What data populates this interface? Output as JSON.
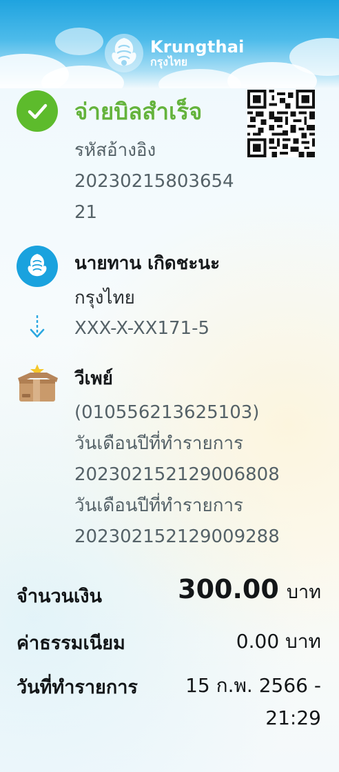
{
  "header": {
    "brand_name": "Krungthai",
    "brand_thai": "กรุงไทย"
  },
  "status": {
    "title": "จ่ายบิลสำเร็จ",
    "ref_label": "รหัสอ้างอิง",
    "ref_line1": "20230215803654",
    "ref_line2": "21"
  },
  "sender": {
    "name": "นายทาน เกิดชะนะ",
    "bank": "กรุงไทย",
    "account": "XXX-X-XX171-5"
  },
  "receiver": {
    "name": "วีเพย์",
    "tax_id": "(010556213625103)",
    "line1_label": "วันเดือนปีที่ทำรายการ",
    "line1_value": "20230215212900680​8",
    "line2_label": "วันเดือนปีที่ทำรายการ",
    "line2_value": "20230215212900928​8"
  },
  "summary": {
    "amount_label": "จำนวนเงิน",
    "amount_value": "300.00",
    "amount_unit": "บาท",
    "fee_label": "ค่าธรรมเนียม",
    "fee_value": "0.00 บาท",
    "date_label": "วันที่ทำรายการ",
    "date_value_line1": "15 ก.พ. 2566 -",
    "date_value_line2": "21:29"
  },
  "colors": {
    "success_green": "#64b33c",
    "krungthai_blue": "#1aa2de"
  },
  "icons": [
    "check-icon",
    "qr-code-icon",
    "krungthai-logo-icon",
    "arrow-down-icon",
    "merchant-box-icon"
  ]
}
